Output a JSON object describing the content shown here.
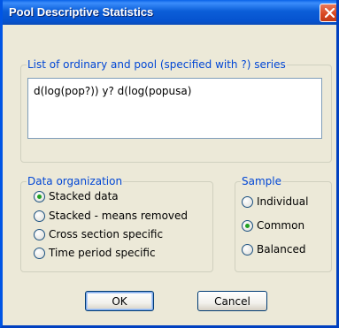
{
  "window": {
    "title": "Pool Descriptive Statistics"
  },
  "series_group": {
    "legend": "List of ordinary and pool (specified with ?) series",
    "value": "d(log(pop?)) y? d(log(popusa)"
  },
  "data_organization": {
    "legend": "Data organization",
    "options": [
      {
        "label": "Stacked data",
        "checked": true
      },
      {
        "label": "Stacked - means removed",
        "checked": false
      },
      {
        "label": "Cross section specific",
        "checked": false
      },
      {
        "label": "Time period specific",
        "checked": false
      }
    ]
  },
  "sample": {
    "legend": "Sample",
    "options": [
      {
        "label": "Individual",
        "checked": false
      },
      {
        "label": "Common",
        "checked": true
      },
      {
        "label": "Balanced",
        "checked": false
      }
    ]
  },
  "buttons": {
    "ok_label": "OK",
    "cancel_label": "Cancel"
  },
  "colors": {
    "title_bar": "#0b5ed8",
    "group_legend": "#0046d5",
    "radio_checked": "#21a121",
    "close_button": "#d8461f"
  },
  "icons": {
    "close": "close-icon"
  }
}
